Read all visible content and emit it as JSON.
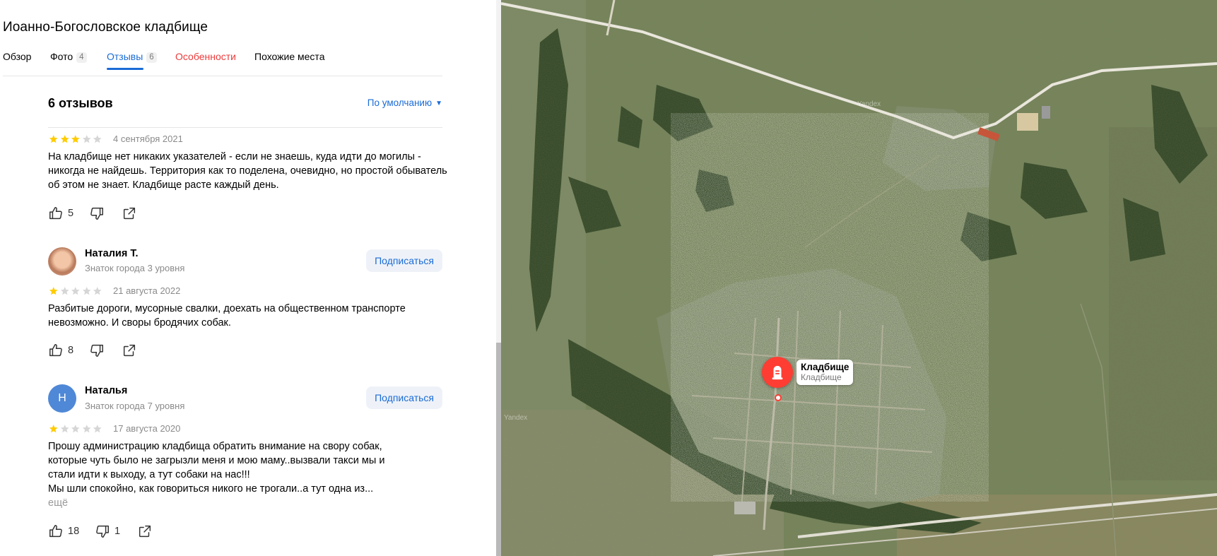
{
  "place": {
    "title": "Иоанно-Богословское кладбище"
  },
  "tabs": [
    {
      "label": "Обзор"
    },
    {
      "label": "Фото",
      "count": "4"
    },
    {
      "label": "Отзывы",
      "count": "6"
    },
    {
      "label": "Особенности"
    },
    {
      "label": "Похожие места"
    }
  ],
  "reviews_header": {
    "title": "6 отзывов",
    "sort_label": "По умолчанию"
  },
  "reviews": [
    {
      "rating": 3,
      "date": "4 сентября 2021",
      "text": "На кладбище нет никаких указателей - если не знаешь, куда идти до могилы - никогда не найдешь. Территория как то поделена, очевидно, но простой обыватель об этом не знает. Кладбище расте каждый день.",
      "likes": "5",
      "dislikes": ""
    },
    {
      "author": "Наталия Т.",
      "level": "Знаток города 3 уровня",
      "subscribe": "Подписаться",
      "rating": 1,
      "date": "21 августа 2022",
      "text": "Разбитые дороги, мусорные свалки, доехать на общественном транспорте невозможно. И своры бродячих собак.",
      "likes": "8",
      "dislikes": ""
    },
    {
      "author": "Наталья",
      "avatar_letter": "Н",
      "level": "Знаток города 7 уровня",
      "subscribe": "Подписаться",
      "rating": 1,
      "date": "17 августа 2020",
      "text_lines": [
        "Прошу администрацию кладбища обратить внимание на свору собак,",
        "которые чуть было не загрызли меня и мою маму..вызвали такси мы и",
        "стали идти к выходу, а тут собаки на нас!!!",
        "Мы шли спокойно, как говориться никого не трогали..а тут одна из..."
      ],
      "more": "ещё",
      "likes": "18",
      "dislikes": "1"
    }
  ],
  "map": {
    "marker_title": "Кладбище",
    "marker_subtitle": "Кладбище",
    "watermark": "Yandex"
  },
  "colors": {
    "accent": "#1a6bd6",
    "star": "#fc0",
    "marker": "#ff3d33",
    "tab_red": "#ec3b3b"
  }
}
